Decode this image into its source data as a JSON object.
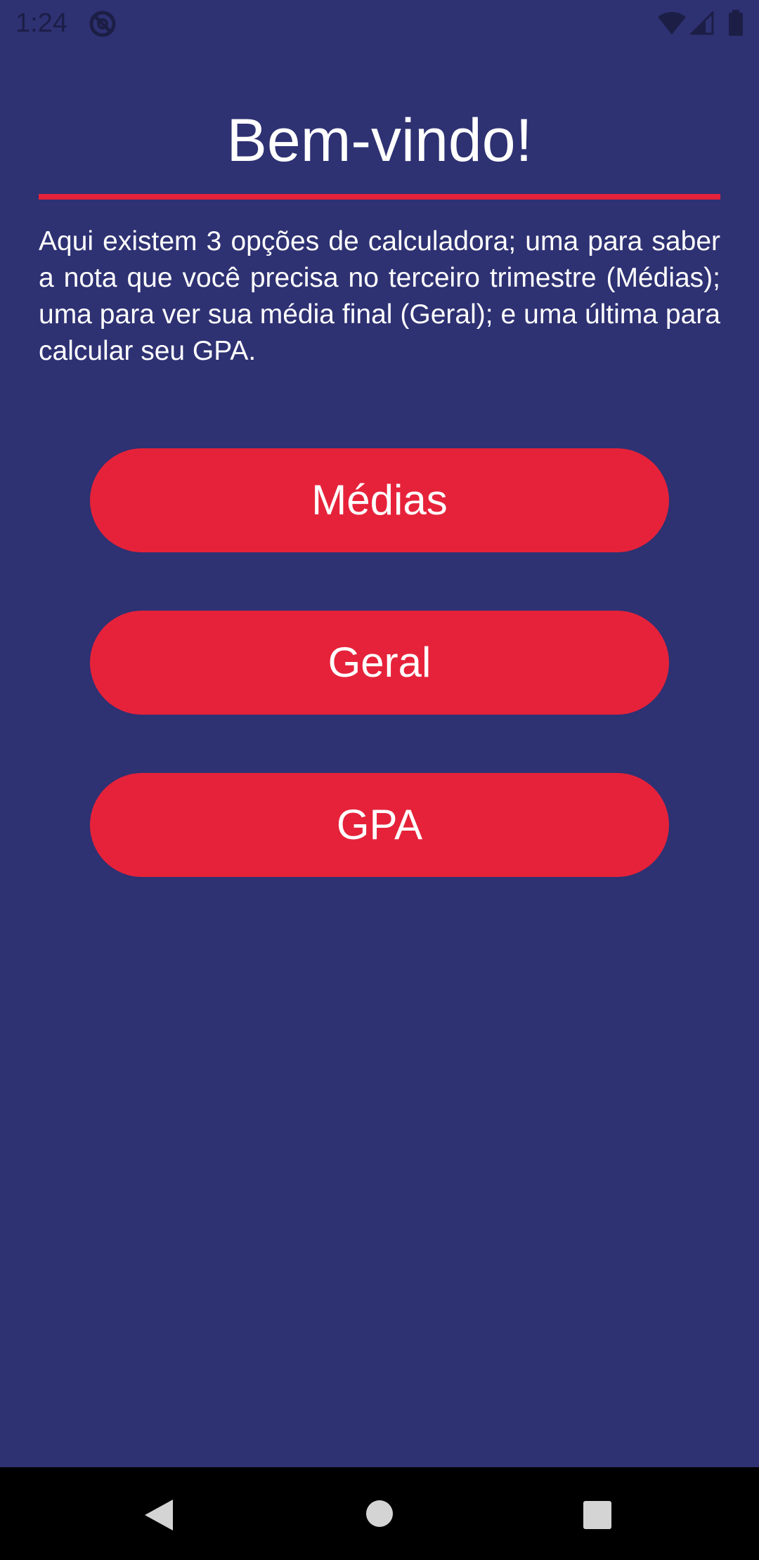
{
  "status_bar": {
    "time": "1:24",
    "icons": [
      "do-not-disturb-icon",
      "wifi-icon",
      "cell-signal-icon",
      "battery-icon"
    ]
  },
  "main": {
    "title": "Bem-vindo!",
    "description": "Aqui existem 3 opções de calculadora; uma para saber a nota que você precisa no terceiro trimestre (Médias); uma para ver sua média final (Geral); e uma última para calcular seu GPA.",
    "buttons": [
      {
        "label": "Médias"
      },
      {
        "label": "Geral"
      },
      {
        "label": "GPA"
      }
    ]
  },
  "nav_bar": {
    "icons": [
      "back-icon",
      "home-icon",
      "recents-icon"
    ]
  },
  "colors": {
    "background": "#2e3172",
    "accent": "#e6223a",
    "text": "#ffffff",
    "nav_bar": "#000000"
  }
}
